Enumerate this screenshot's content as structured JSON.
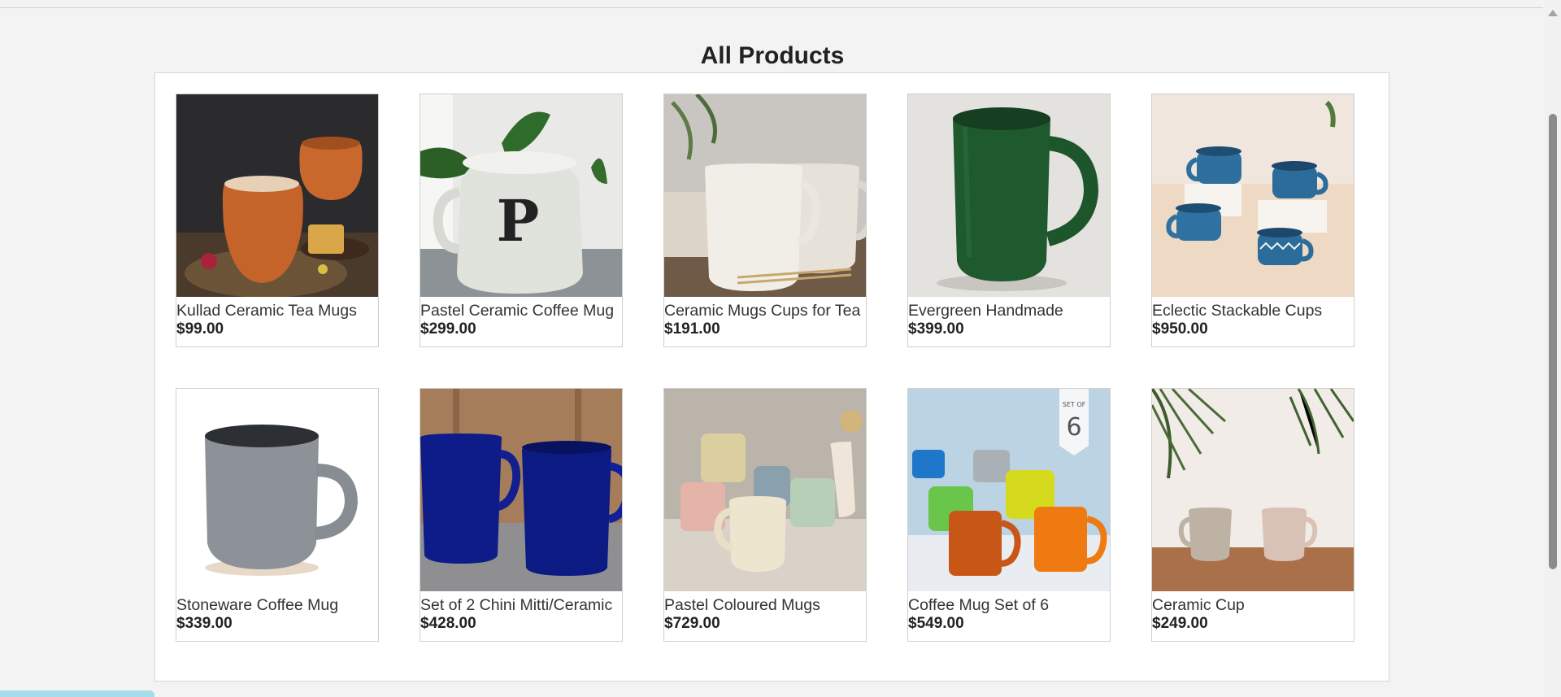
{
  "page": {
    "title": "All Products"
  },
  "products": [
    {
      "name": "Kullad Ceramic Tea Mugs",
      "price": "$99.00",
      "image": "terracotta-kullad-cups"
    },
    {
      "name": "Pastel Ceramic Coffee Mug",
      "price": "$299.00",
      "image": "white-monogram-mug"
    },
    {
      "name": "Ceramic Mugs Cups for Tea",
      "price": "$191.00",
      "image": "cream-textured-mugs"
    },
    {
      "name": "Evergreen Handmade",
      "price": "$399.00",
      "image": "green-glazed-mug"
    },
    {
      "name": "Eclectic Stackable Cups",
      "price": "$950.00",
      "image": "blue-patterned-cups"
    },
    {
      "name": "Stoneware Coffee Mug",
      "price": "$339.00",
      "image": "grey-stoneware-mug"
    },
    {
      "name": "Set of 2 Chini Mitti/Ceramic",
      "price": "$428.00",
      "image": "navy-blue-mugs"
    },
    {
      "name": "Pastel Coloured Mugs",
      "price": "$729.00",
      "image": "pastel-speckled-mugs"
    },
    {
      "name": "Coffee Mug Set of 6",
      "price": "$549.00",
      "image": "colourful-mug-set",
      "badge_top": "SET OF",
      "badge_number": "6"
    },
    {
      "name": "Ceramic Cup",
      "price": "$249.00",
      "image": "beige-cups-palm"
    }
  ],
  "colors": {
    "page_bg": "#f3f3f3",
    "panel_bg": "#ffffff",
    "scroll_thumb": "#8b8b8b",
    "corner_tab": "#a8dcea"
  }
}
